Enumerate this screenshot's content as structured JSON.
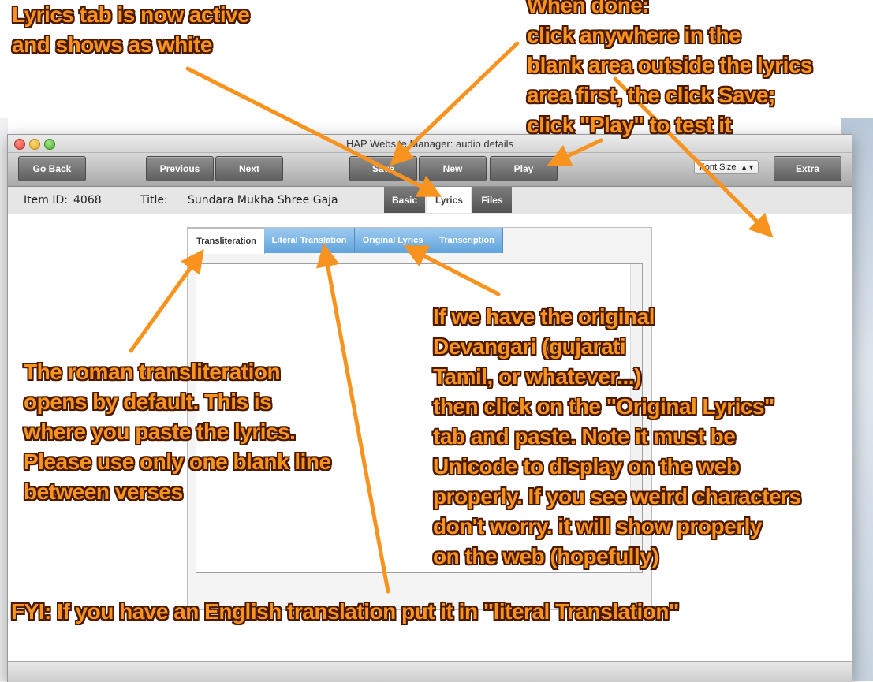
{
  "window": {
    "title": "HAP Website Manager: audio details"
  },
  "toolbar": {
    "go_back": "Go Back",
    "previous": "Previous",
    "next": "Next",
    "save": "Save",
    "new": "New",
    "play": "Play",
    "font_size": "Font Size",
    "extra": "Extra"
  },
  "item": {
    "id_label": "Item ID:",
    "id_value": "4068",
    "title_label": "Title:",
    "title_value": "Sundara Mukha Shree Gaja"
  },
  "detail_tabs": [
    {
      "label": "Basic",
      "active": false
    },
    {
      "label": "Lyrics",
      "active": true
    },
    {
      "label": "Files",
      "active": false
    }
  ],
  "lyrics_tabs": [
    {
      "label": "Transliteration",
      "active": true
    },
    {
      "label": "Literal Translation",
      "active": false
    },
    {
      "label": "Original Lyrics",
      "active": false
    },
    {
      "label": "Transcription",
      "active": false
    }
  ],
  "lyrics_text": "",
  "annotations": {
    "lyrics_tab": "Lyrics tab is now active\nand shows as white",
    "when_done": "When done:\nclick anywhere in the\nblank area outside the lyrics\narea first, the click Save;\nclick \"Play\" to test it",
    "roman": "The roman transliteration\nopens by default. This is\nwhere you paste the lyrics.\nPlease use only one blank line\nbetween verses",
    "original": "If we have the original\nDevangari (gujarati\nTamil, or whatever...)\nthen click on the \"Original Lyrics\"\ntab and paste. Note it must be\nUnicode to display on the web\nproperly. If you see weird characters\ndon't worry. it will show properly\non the web (hopefully)",
    "fyi": "FYI: If you have an English translation put it in \"literal Translation\""
  },
  "colors": {
    "annotation": "#f7931e",
    "annotation_outline": "#4a1a00",
    "tab_blue": "#5fa3dd"
  }
}
